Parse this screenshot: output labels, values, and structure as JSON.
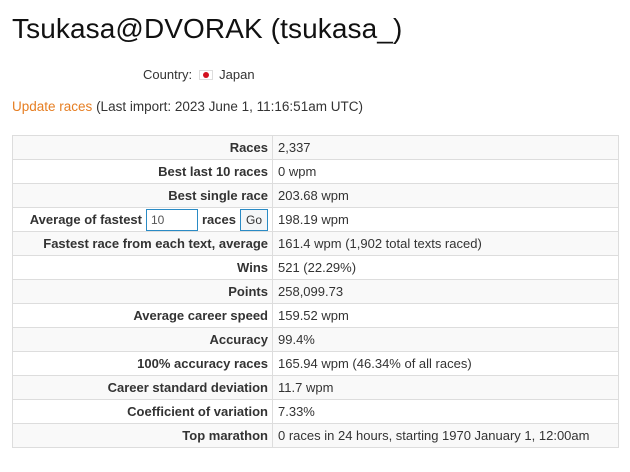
{
  "header": {
    "title": "Tsukasa@DVORAK (tsukasa_)"
  },
  "profile": {
    "country_label": "Country:",
    "country": "Japan",
    "flag_icon": "japan-flag-icon"
  },
  "update": {
    "link_label": "Update races",
    "last_import": "(Last import: 2023 June 1, 11:16:51am UTC)"
  },
  "stats": {
    "races": {
      "label": "Races",
      "value": "2,337"
    },
    "best_last_10": {
      "label": "Best last 10 races",
      "value": "0 wpm"
    },
    "best_single": {
      "label": "Best single race",
      "value": "203.68 wpm"
    },
    "avg_fastest": {
      "label_prefix": "Average of fastest",
      "input_value": "10",
      "label_suffix": "races",
      "go_label": "Go",
      "value": "198.19 wpm"
    },
    "fastest_each_text": {
      "label": "Fastest race from each text, average",
      "value": "161.4 wpm (1,902 total texts raced)"
    },
    "wins": {
      "label": "Wins",
      "value": "521 (22.29%)"
    },
    "points": {
      "label": "Points",
      "value": "258,099.73"
    },
    "avg_career_speed": {
      "label": "Average career speed",
      "value": "159.52 wpm"
    },
    "accuracy": {
      "label": "Accuracy",
      "value": "99.4%"
    },
    "perfect_accuracy": {
      "label": "100% accuracy races",
      "value": "165.94 wpm (46.34% of all races)"
    },
    "career_std_dev": {
      "label": "Career standard deviation",
      "value": "11.7 wpm"
    },
    "coef_variation": {
      "label": "Coefficient of variation",
      "value": "7.33%"
    },
    "top_marathon": {
      "label": "Top marathon",
      "value": "0 races in 24 hours, starting 1970 January 1, 12:00am"
    }
  },
  "colors": {
    "link": "#e67e22",
    "input_border": "#2a8bc5",
    "flag_red": "#d2101e"
  }
}
